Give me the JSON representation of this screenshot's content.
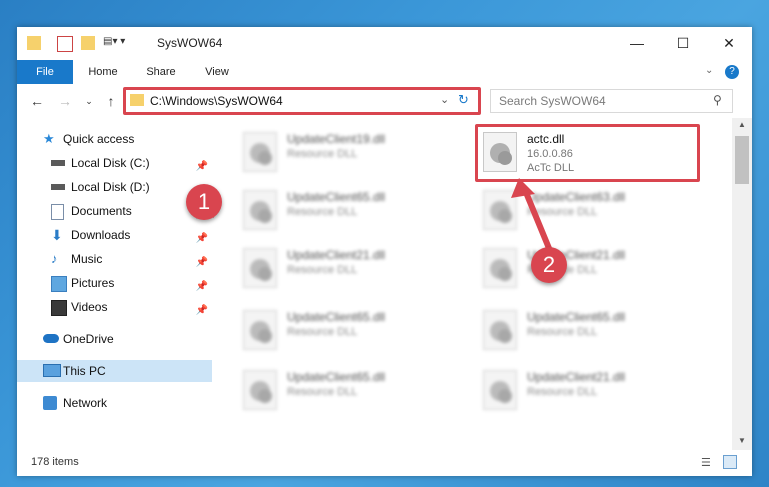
{
  "window": {
    "title": "SysWOW64",
    "controls": {
      "minimize": "—",
      "maximize": "☐",
      "close": "✕"
    }
  },
  "ribbon": {
    "tabs": [
      "File",
      "Home",
      "Share",
      "View"
    ]
  },
  "address": {
    "path": "C:\\Windows\\SysWOW64"
  },
  "search": {
    "placeholder": "Search SysWOW64"
  },
  "sidebar": {
    "items": [
      {
        "label": "Quick access",
        "icon": "star-icon"
      },
      {
        "label": "Local Disk (C:)",
        "icon": "drive-icon",
        "pinned": true
      },
      {
        "label": "Local Disk (D:)",
        "icon": "drive-icon"
      },
      {
        "label": "Documents",
        "icon": "documents-icon",
        "pinned": true
      },
      {
        "label": "Downloads",
        "icon": "download-icon",
        "pinned": true
      },
      {
        "label": "Music",
        "icon": "music-icon",
        "pinned": true
      },
      {
        "label": "Pictures",
        "icon": "pictures-icon",
        "pinned": true
      },
      {
        "label": "Videos",
        "icon": "videos-icon",
        "pinned": true
      },
      {
        "label": "OneDrive",
        "icon": "cloud-icon"
      },
      {
        "label": "This PC",
        "icon": "computer-icon"
      },
      {
        "label": "Network",
        "icon": "network-icon"
      }
    ]
  },
  "files": [
    {
      "name": "UpdateClient19.dll",
      "type": "Resource DLL"
    },
    {
      "name": "actc.dll",
      "version": "16.0.0.86",
      "type": "AcTc DLL"
    },
    {
      "name": "UpdateClient65.dll",
      "type": "Resource DLL"
    },
    {
      "name": "UpdateClient63.dll",
      "type": "Resource DLL"
    },
    {
      "name": "UpdateClient21.dll",
      "type": "Resource DLL"
    },
    {
      "name": "UpdateClient21.dll",
      "type": "Resource DLL"
    },
    {
      "name": "UpdateClient65.dll",
      "type": "Resource DLL"
    },
    {
      "name": "UpdateClient65.dll",
      "type": "Resource DLL"
    },
    {
      "name": "UpdateClient65.dll",
      "type": "Resource DLL"
    },
    {
      "name": "UpdateClient21.dll",
      "type": "Resource DLL"
    }
  ],
  "status": {
    "item_count": "178 items"
  },
  "annotations": {
    "step1": "1",
    "step2": "2"
  },
  "colors": {
    "accent": "#1979ca",
    "highlight": "#d9454f",
    "selected": "#cce4f7"
  }
}
